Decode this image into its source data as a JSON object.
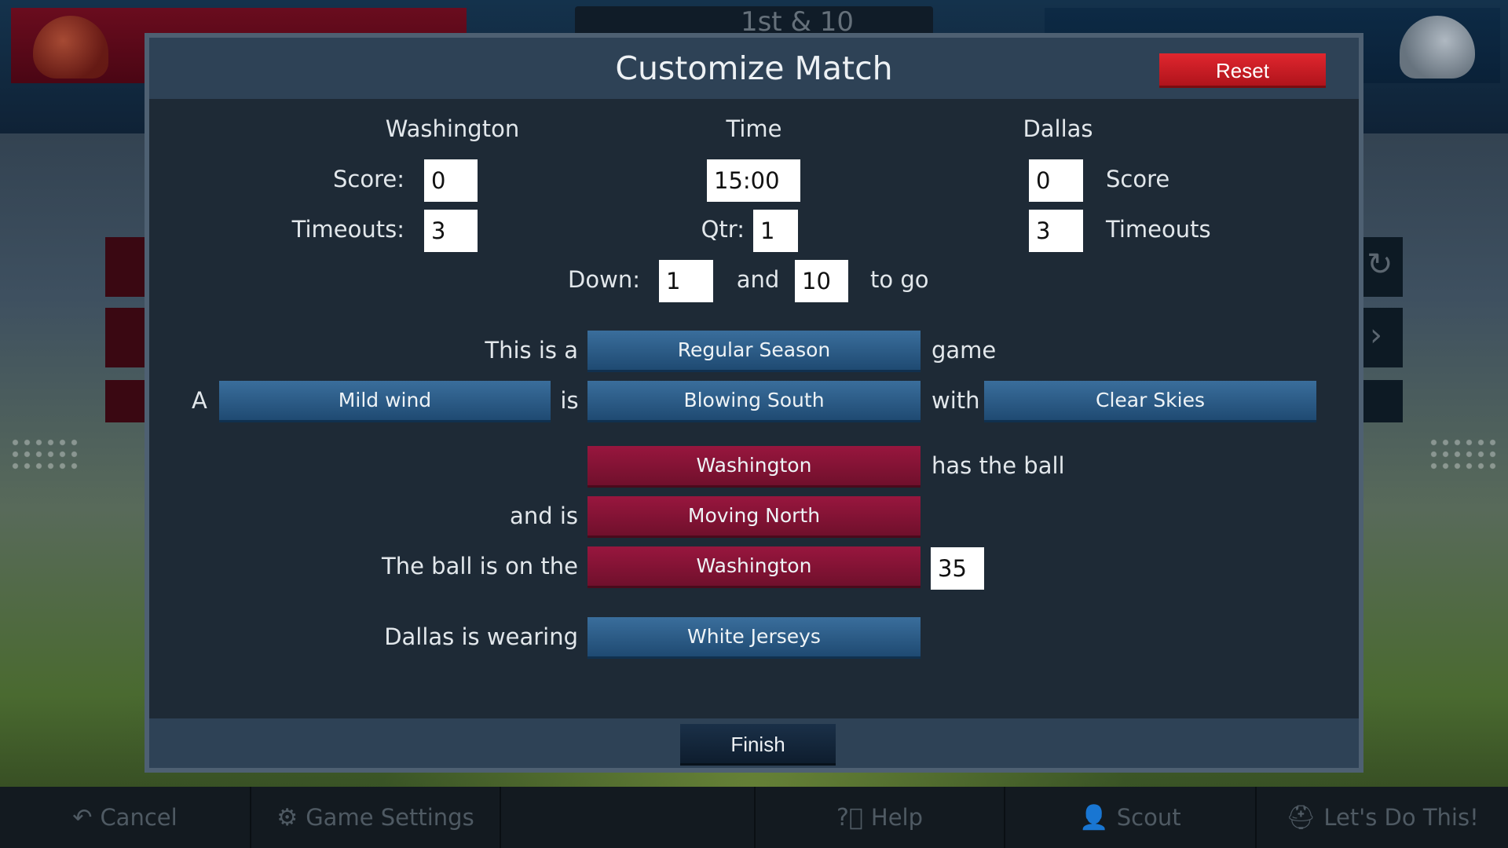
{
  "background": {
    "down_distance": "1st & 10",
    "bottom_nav": [
      {
        "label": "Cancel",
        "icon": "undo-arrow-icon"
      },
      {
        "label": "Game Settings",
        "icon": "gear-icon"
      },
      {
        "label": "",
        "icon": ""
      },
      {
        "label": "Help",
        "icon": "help-icon"
      },
      {
        "label": "Scout",
        "icon": "person-icon"
      },
      {
        "label": "Let's Do This!",
        "icon": "helmet-icon"
      }
    ]
  },
  "modal": {
    "title": "Customize Match",
    "reset_label": "Reset",
    "finish_label": "Finish",
    "home": {
      "team": "Washington",
      "score_label": "Score:",
      "score": "0",
      "timeouts_label": "Timeouts:",
      "timeouts": "3"
    },
    "time": {
      "header": "Time",
      "clock": "15:00",
      "qtr_label": "Qtr:",
      "qtr": "1"
    },
    "away": {
      "team": "Dallas",
      "score_label": "Score",
      "score": "0",
      "timeouts_label": "Timeouts",
      "timeouts": "3"
    },
    "down": {
      "label": "Down:",
      "down": "1",
      "and_label": "and",
      "distance": "10",
      "togo_label": "to go"
    },
    "game_type": {
      "prefix": "This is a",
      "value": "Regular Season",
      "suffix": "game"
    },
    "weather": {
      "prefix": "A",
      "wind": "Mild wind",
      "is_label": "is",
      "direction": "Blowing South",
      "with_label": "with",
      "sky": "Clear Skies"
    },
    "possession": {
      "team": "Washington",
      "suffix": "has the ball",
      "and_is_label": "and is",
      "direction": "Moving North"
    },
    "ball_on": {
      "prefix": "The ball is on the",
      "side": "Washington",
      "yard_line": "35"
    },
    "jerseys": {
      "prefix": "Dallas is wearing",
      "value": "White Jerseys"
    }
  },
  "colors": {
    "modal_bg": "#1e2a36",
    "header_bg": "#2e4256",
    "reset_red": "#d41e26",
    "selector_blue": "#2c5a86",
    "selector_maroon": "#861234"
  }
}
